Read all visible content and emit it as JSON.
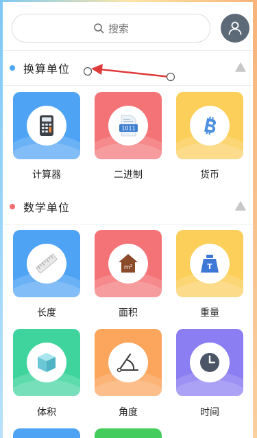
{
  "search": {
    "placeholder": "搜索"
  },
  "sections": [
    {
      "title": "换算单位",
      "dot_color": "#4aa6f0",
      "items": [
        {
          "label": "计算器",
          "icon": "calculator-icon",
          "color": "#4ea3f5"
        },
        {
          "label": "二进制",
          "icon": "binary-icon",
          "color": "#f47377"
        },
        {
          "label": "货币",
          "icon": "bitcoin-icon",
          "color": "#fccf5a"
        }
      ]
    },
    {
      "title": "数学单位",
      "dot_color": "#f06e72",
      "items": [
        {
          "label": "长度",
          "icon": "ruler-icon",
          "color": "#4ea3f5"
        },
        {
          "label": "面积",
          "icon": "area-house-icon",
          "color": "#f47377"
        },
        {
          "label": "重量",
          "icon": "weight-icon",
          "color": "#fccf5a"
        },
        {
          "label": "体积",
          "icon": "cube-icon",
          "color": "#3fd49e"
        },
        {
          "label": "角度",
          "icon": "angle-icon",
          "color": "#fca55c"
        },
        {
          "label": "时间",
          "icon": "clock-icon",
          "color": "#8b7df2"
        }
      ]
    }
  ],
  "icon_texts": {
    "binary": "1011",
    "area": "m²",
    "weight": "T"
  },
  "annotation": {
    "type": "arrow",
    "color": "#e03b3b"
  }
}
